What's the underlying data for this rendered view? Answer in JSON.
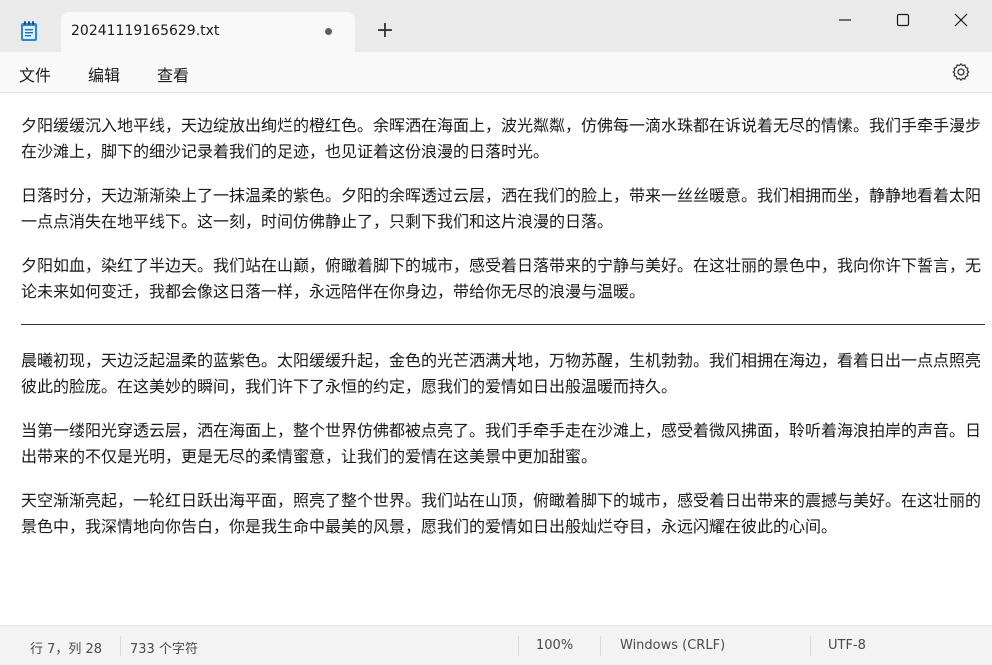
{
  "window": {
    "tab_title": "20241119165629.txt",
    "new_tab_label": "+"
  },
  "menu": {
    "file": "文件",
    "edit": "编辑",
    "view": "查看"
  },
  "editor": {
    "paragraphs": [
      "夕阳缓缓沉入地平线，天边绽放出绚烂的橙红色。余晖洒在海面上，波光粼粼，仿佛每一滴水珠都在诉说着无尽的情愫。我们手牵手漫步在沙滩上，脚下的细沙记录着我们的足迹，也见证着这份浪漫的日落时光。",
      "日落时分，天边渐渐染上了一抹温柔的紫色。夕阳的余晖透过云层，洒在我们的脸上，带来一丝丝暖意。我们相拥而坐，静静地看着太阳一点点消失在地平线下。这一刻，时间仿佛静止了，只剩下我们和这片浪漫的日落。",
      "夕阳如血，染红了半边天。我们站在山巅，俯瞰着脚下的城市，感受着日落带来的宁静与美好。在这壮丽的景色中，我向你许下誓言，无论未来如何变迁，我都会像这日落一样，永远陪伴在你身边，带给你无尽的浪漫与温暖。",
      "晨曦初现，天边泛起温柔的蓝紫色。太阳缓缓升起，金色的光芒洒满大地，万物苏醒，生机勃勃。我们相拥在海边，看着日出一点点照亮彼此的脸庞。在这美妙的瞬间，我们许下了永恒的约定，愿我们的爱情如日出般温暖而持久。",
      "当第一缕阳光穿透云层，洒在海面上，整个世界仿佛都被点亮了。我们手牵手走在沙滩上，感受着微风拂面，聆听着海浪拍岸的声音。日出带来的不仅是光明，更是无尽的柔情蜜意，让我们的爱情在这美景中更加甜蜜。",
      "天空渐渐亮起，一轮红日跃出海平面，照亮了整个世界。我们站在山顶，俯瞰着脚下的城市，感受着日出带来的震撼与美好。在这壮丽的景色中，我深情地向你告白，你是我生命中最美的风景，愿我们的爱情如日出般灿烂夺目，永远闪耀在彼此的心间。"
    ]
  },
  "status": {
    "position": "行 7，列 28",
    "char_count": "733 个字符",
    "zoom": "100%",
    "line_ending": "Windows (CRLF)",
    "encoding": "UTF-8"
  },
  "icons": {
    "app": "notepad-icon",
    "settings": "gear-icon",
    "minimize": "minimize-icon",
    "maximize": "maximize-icon",
    "close": "close-icon",
    "unsaved": "unsaved-dot-icon"
  },
  "colors": {
    "titlebar": "#eaeaea",
    "editor_bg": "#ffffff",
    "app_icon": "#1f6fb8"
  }
}
